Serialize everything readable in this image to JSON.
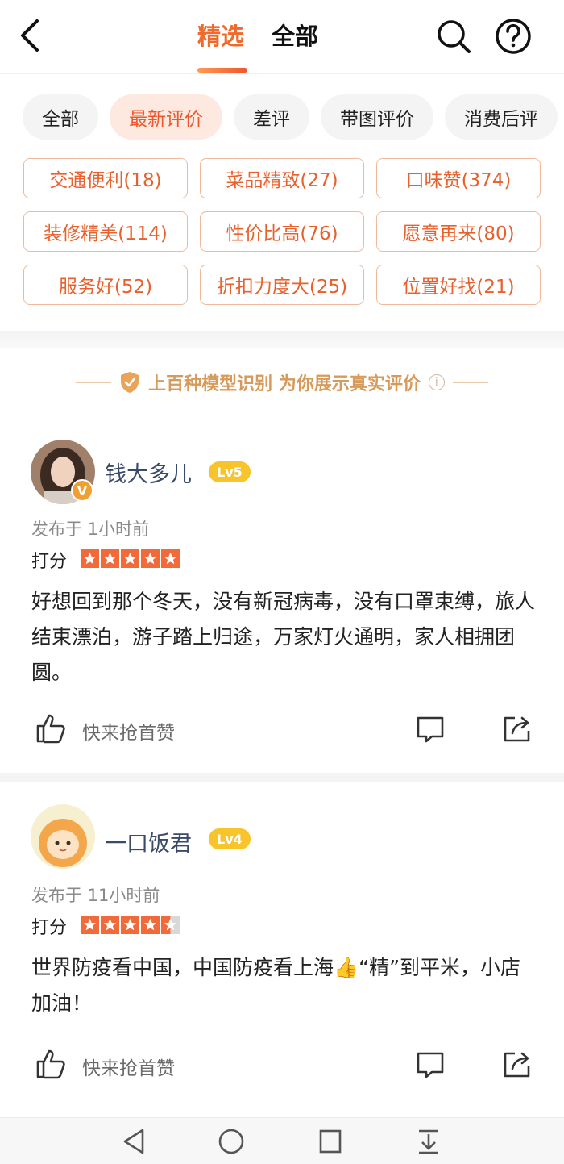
{
  "header": {
    "tabs": [
      {
        "label": "精选",
        "active": true
      },
      {
        "label": "全部",
        "active": false
      }
    ],
    "icons": [
      "back-arrow-icon",
      "search-icon",
      "help-icon"
    ]
  },
  "filter_chips": [
    {
      "label": "全部",
      "active": false
    },
    {
      "label": "最新评价",
      "active": true
    },
    {
      "label": "差评",
      "active": false
    },
    {
      "label": "带图评价",
      "active": false
    },
    {
      "label": "消费后评",
      "active": false
    }
  ],
  "tags": [
    "交通便利(18)",
    "菜品精致(27)",
    "口味赞(374)",
    "装修精美(114)",
    "性价比高(76)",
    "愿意再来(80)",
    "服务好(52)",
    "折扣力度大(25)",
    "位置好找(21)"
  ],
  "banner": {
    "text": "上百种模型识别 为你展示真实评价",
    "info_symbol": "i"
  },
  "reviews": [
    {
      "username": "钱大多儿",
      "level": "Lv5",
      "verified_badge": "V",
      "time": "发布于 1小时前",
      "score_label": "打分",
      "stars": 5,
      "content": "好想回到那个冬天，没有新冠病毒，没有口罩束缚，旅人结束漂泊，游子踏上归途，万家灯火通明，家人相拥团圆。",
      "like_text": "快来抢首赞"
    },
    {
      "username": "一口饭君",
      "level": "Lv4",
      "time": "发布于 11小时前",
      "score_label": "打分",
      "stars": 4.5,
      "content": "世界防疫看中国，中国防疫看上海👍“精”到平米，小店加油！",
      "like_text": "快来抢首赞"
    }
  ],
  "colors": {
    "accent": "#f0562c",
    "tag_border": "#f2b89b",
    "star": "#f26a3a",
    "level_badge": "#f7c42c",
    "banner_text": "#d89a5a"
  },
  "system_nav": [
    "nav-back-icon",
    "nav-home-icon",
    "nav-recents-icon",
    "nav-collapse-icon"
  ]
}
